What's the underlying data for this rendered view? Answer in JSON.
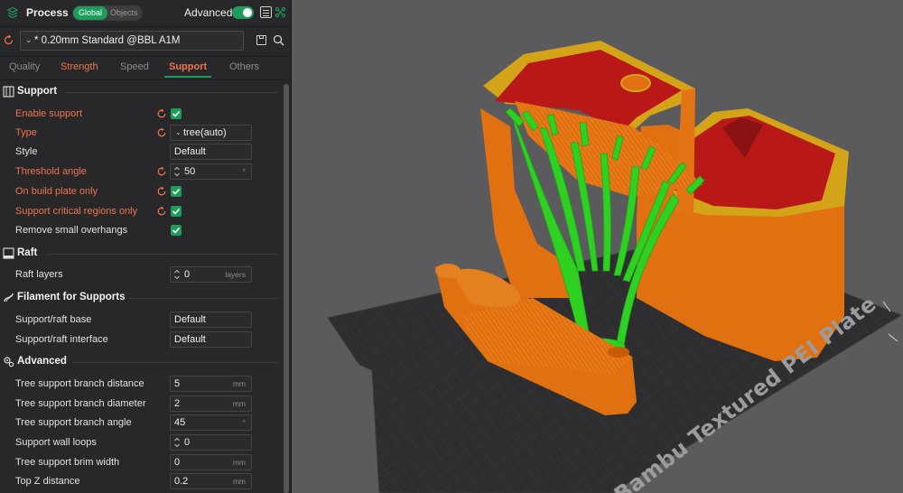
{
  "header": {
    "title": "Process",
    "mode_global": "Global",
    "mode_objects": "Objects",
    "advanced_label": "Advanced",
    "advanced_on": true,
    "accent": "#1c9e5a"
  },
  "preset": {
    "name": "* 0.20mm Standard @BBL A1M"
  },
  "tabs": [
    {
      "label": "Quality",
      "state": "normal"
    },
    {
      "label": "Strength",
      "state": "modified"
    },
    {
      "label": "Speed",
      "state": "normal"
    },
    {
      "label": "Support",
      "state": "active"
    },
    {
      "label": "Others",
      "state": "normal"
    }
  ],
  "sections": {
    "support": {
      "title": "Support"
    },
    "raft": {
      "title": "Raft"
    },
    "filament": {
      "title": "Filament for Supports"
    },
    "advanced": {
      "title": "Advanced"
    }
  },
  "support": {
    "enable_support": {
      "label": "Enable support",
      "checked": true
    },
    "type": {
      "label": "Type",
      "value": "tree(auto)"
    },
    "style": {
      "label": "Style",
      "value": "Default"
    },
    "threshold_angle": {
      "label": "Threshold angle",
      "value": "50",
      "unit": "°"
    },
    "on_build_plate_only": {
      "label": "On build plate only",
      "checked": true
    },
    "critical_regions": {
      "label": "Support critical regions only",
      "checked": true
    },
    "remove_small_overhangs": {
      "label": "Remove small overhangs",
      "checked": true
    }
  },
  "raft": {
    "raft_layers": {
      "label": "Raft layers",
      "value": "0",
      "unit": "layers"
    }
  },
  "filament": {
    "base": {
      "label": "Support/raft base",
      "value": "Default"
    },
    "interface": {
      "label": "Support/raft interface",
      "value": "Default"
    }
  },
  "advanced": {
    "branch_distance": {
      "label": "Tree support branch distance",
      "value": "5",
      "unit": "mm"
    },
    "branch_diameter": {
      "label": "Tree support branch diameter",
      "value": "2",
      "unit": "mm"
    },
    "branch_angle": {
      "label": "Tree support branch angle",
      "value": "45",
      "unit": "°"
    },
    "wall_loops": {
      "label": "Support wall loops",
      "value": "0"
    },
    "brim_width": {
      "label": "Tree support brim width",
      "value": "0",
      "unit": "mm"
    },
    "top_z_distance": {
      "label": "Top Z distance",
      "value": "0.2",
      "unit": "mm"
    }
  },
  "viewport": {
    "plate_label": "Bambu Textured PEI Plate",
    "colors": {
      "model": "#e07010",
      "support": "#2ed022",
      "overhang": "#b81818",
      "top": "#d4a418",
      "background": "#5b5b5d",
      "plate": "#2c2c2e"
    }
  }
}
